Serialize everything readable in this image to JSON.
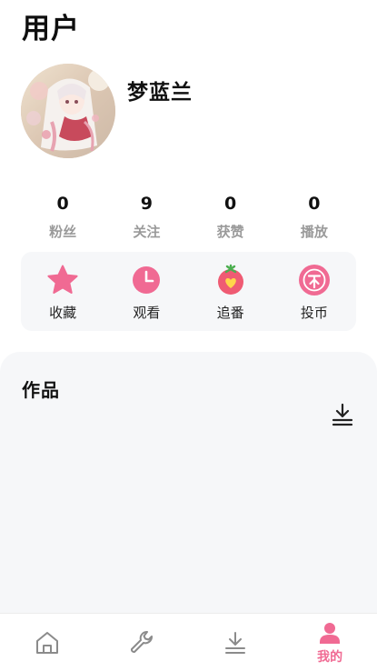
{
  "page": {
    "title": "用户"
  },
  "profile": {
    "name": "梦蓝兰"
  },
  "stats": [
    {
      "value": "0",
      "label": "粉丝"
    },
    {
      "value": "9",
      "label": "关注"
    },
    {
      "value": "0",
      "label": "获赞"
    },
    {
      "value": "0",
      "label": "播放"
    }
  ],
  "quick_actions": [
    {
      "label": "收藏",
      "icon": "star-icon"
    },
    {
      "label": "观看",
      "icon": "clock-icon"
    },
    {
      "label": "追番",
      "icon": "tomato-heart-icon"
    },
    {
      "label": "投币",
      "icon": "coin-icon"
    }
  ],
  "works": {
    "title": "作品",
    "download_icon": "download-icon"
  },
  "bottom_nav": {
    "items": [
      {
        "icon": "home-icon",
        "label": ""
      },
      {
        "icon": "wrench-icon",
        "label": ""
      },
      {
        "icon": "download-icon",
        "label": ""
      },
      {
        "icon": "user-icon",
        "label": "我的",
        "active": true
      }
    ]
  },
  "colors": {
    "accent": "#F06A93",
    "muted_text": "#9A9A9A",
    "panel_bg": "#F6F7F9"
  }
}
